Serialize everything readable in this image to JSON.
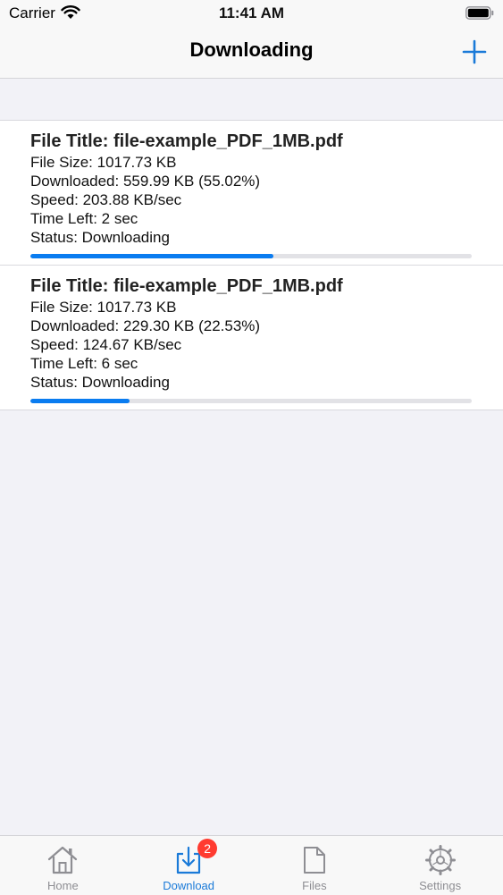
{
  "status_bar": {
    "carrier": "Carrier",
    "time": "11:41 AM"
  },
  "nav": {
    "title": "Downloading",
    "add_icon": "plus-icon"
  },
  "downloads": [
    {
      "title": "File Title: file-example_PDF_1MB.pdf",
      "file_size": "File Size: 1017.73 KB",
      "downloaded": "Downloaded: 559.99 KB (55.02%)",
      "speed": "Speed: 203.88 KB/sec",
      "time_left": "Time Left: 2 sec",
      "status": "Status: Downloading",
      "progress": 0.5502
    },
    {
      "title": "File Title: file-example_PDF_1MB.pdf",
      "file_size": "File Size: 1017.73 KB",
      "downloaded": "Downloaded: 229.30 KB (22.53%)",
      "speed": "Speed: 124.67 KB/sec",
      "time_left": "Time Left: 6 sec",
      "status": "Status: Downloading",
      "progress": 0.2253
    }
  ],
  "tabs": [
    {
      "label": "Home",
      "icon": "home-icon",
      "active": false
    },
    {
      "label": "Download",
      "icon": "download-icon",
      "active": true,
      "badge": "2"
    },
    {
      "label": "Files",
      "icon": "file-icon",
      "active": false
    },
    {
      "label": "Settings",
      "icon": "gear-icon",
      "active": false
    }
  ],
  "colors": {
    "accent": "#1a7ad8",
    "progress": "#0a7cf0",
    "badge": "#ff3b30"
  }
}
